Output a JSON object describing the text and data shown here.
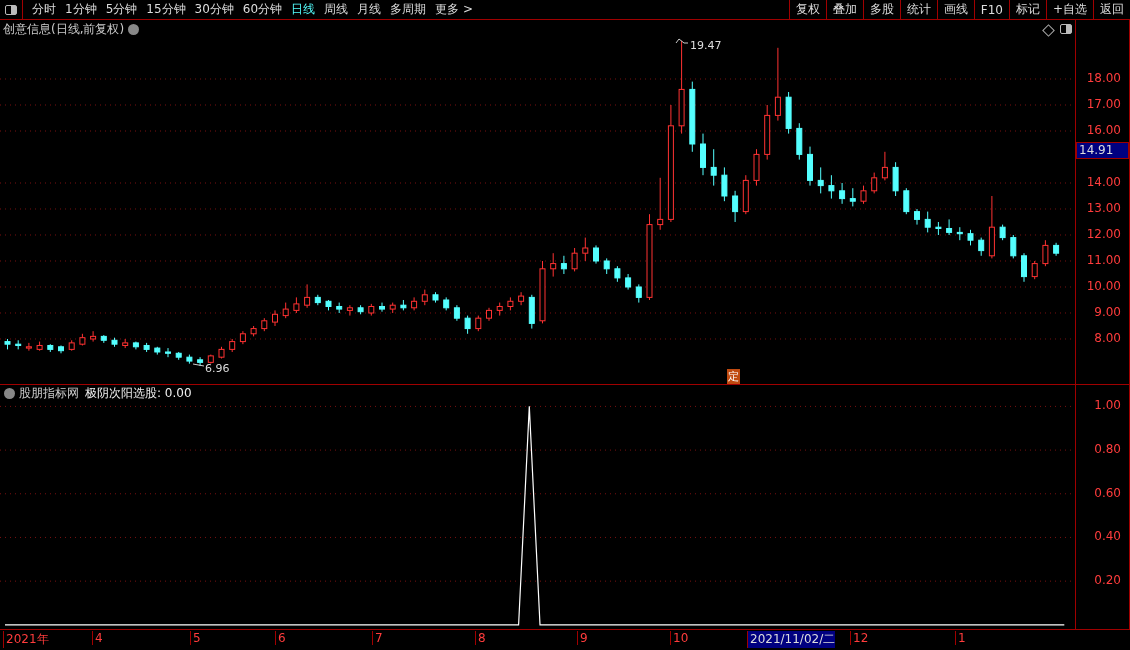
{
  "toolbar": {
    "periods": [
      {
        "label": "分时",
        "selected": false
      },
      {
        "label": "1分钟",
        "selected": false
      },
      {
        "label": "5分钟",
        "selected": false
      },
      {
        "label": "15分钟",
        "selected": false
      },
      {
        "label": "30分钟",
        "selected": false
      },
      {
        "label": "60分钟",
        "selected": false
      },
      {
        "label": "日线",
        "selected": true
      },
      {
        "label": "周线",
        "selected": false
      },
      {
        "label": "月线",
        "selected": false
      },
      {
        "label": "多周期",
        "selected": false
      }
    ],
    "more": "更多 >",
    "actions": [
      "复权",
      "叠加",
      "多股",
      "统计",
      "画线",
      "F10",
      "标记",
      "+自选",
      "返回"
    ]
  },
  "main_chart": {
    "title": "创意信息(日线,前复权)",
    "high_marker": "19.47",
    "low_marker": "6.96",
    "event_marker": "定",
    "price_tag": "14.91",
    "chart_data": {
      "type": "candlestick",
      "grid": true,
      "ylim": [
        6.23,
        20.27
      ],
      "yticks": [
        {
          "value": 18,
          "label": "18.00"
        },
        {
          "value": 17,
          "label": "17.00"
        },
        {
          "value": 16,
          "label": "16.00"
        },
        {
          "value": 14,
          "label": "14.00"
        },
        {
          "value": 13,
          "label": "13.00"
        },
        {
          "value": 12,
          "label": "12.00"
        },
        {
          "value": 11,
          "label": "11.00"
        },
        {
          "value": 10,
          "label": "10.00"
        },
        {
          "value": 9,
          "label": "9.00"
        },
        {
          "value": 8,
          "label": "8.00"
        }
      ],
      "ohlc": [
        [
          7.9,
          8.0,
          7.6,
          7.8
        ],
        [
          7.8,
          7.95,
          7.6,
          7.75
        ],
        [
          7.65,
          7.85,
          7.55,
          7.7
        ],
        [
          7.6,
          7.9,
          7.55,
          7.75
        ],
        [
          7.75,
          7.8,
          7.5,
          7.6
        ],
        [
          7.7,
          7.75,
          7.45,
          7.55
        ],
        [
          7.6,
          7.95,
          7.55,
          7.85
        ],
        [
          7.8,
          8.2,
          7.75,
          8.05
        ],
        [
          8.0,
          8.3,
          7.9,
          8.1
        ],
        [
          8.1,
          8.15,
          7.85,
          7.95
        ],
        [
          7.95,
          8.05,
          7.7,
          7.8
        ],
        [
          7.75,
          8.0,
          7.65,
          7.85
        ],
        [
          7.85,
          7.9,
          7.6,
          7.7
        ],
        [
          7.75,
          7.85,
          7.5,
          7.6
        ],
        [
          7.65,
          7.7,
          7.4,
          7.5
        ],
        [
          7.5,
          7.65,
          7.3,
          7.45
        ],
        [
          7.45,
          7.5,
          7.2,
          7.3
        ],
        [
          7.3,
          7.4,
          7.05,
          7.15
        ],
        [
          7.2,
          7.3,
          6.96,
          7.1
        ],
        [
          7.1,
          7.4,
          7.05,
          7.35
        ],
        [
          7.3,
          7.7,
          7.25,
          7.6
        ],
        [
          7.6,
          8.0,
          7.5,
          7.9
        ],
        [
          7.9,
          8.3,
          7.8,
          8.2
        ],
        [
          8.2,
          8.5,
          8.1,
          8.4
        ],
        [
          8.4,
          8.8,
          8.3,
          8.7
        ],
        [
          8.65,
          9.1,
          8.5,
          8.95
        ],
        [
          8.9,
          9.4,
          8.8,
          9.15
        ],
        [
          9.1,
          9.6,
          9.0,
          9.35
        ],
        [
          9.3,
          10.1,
          9.2,
          9.6
        ],
        [
          9.6,
          9.7,
          9.3,
          9.4
        ],
        [
          9.45,
          9.5,
          9.1,
          9.25
        ],
        [
          9.25,
          9.4,
          9.0,
          9.15
        ],
        [
          9.1,
          9.3,
          8.9,
          9.2
        ],
        [
          9.2,
          9.3,
          8.95,
          9.05
        ],
        [
          9.0,
          9.35,
          8.9,
          9.25
        ],
        [
          9.25,
          9.4,
          9.05,
          9.15
        ],
        [
          9.15,
          9.4,
          9.0,
          9.3
        ],
        [
          9.3,
          9.5,
          9.1,
          9.2
        ],
        [
          9.2,
          9.6,
          9.1,
          9.45
        ],
        [
          9.45,
          9.9,
          9.3,
          9.7
        ],
        [
          9.7,
          9.8,
          9.4,
          9.5
        ],
        [
          9.5,
          9.6,
          9.1,
          9.2
        ],
        [
          9.2,
          9.3,
          8.7,
          8.8
        ],
        [
          8.8,
          8.9,
          8.2,
          8.4
        ],
        [
          8.4,
          8.9,
          8.3,
          8.8
        ],
        [
          8.8,
          9.2,
          8.7,
          9.1
        ],
        [
          9.1,
          9.4,
          8.9,
          9.25
        ],
        [
          9.25,
          9.6,
          9.1,
          9.45
        ],
        [
          9.45,
          9.8,
          9.3,
          9.65
        ],
        [
          9.6,
          9.7,
          8.4,
          8.6
        ],
        [
          8.7,
          11.0,
          8.6,
          10.7
        ],
        [
          10.7,
          11.3,
          10.4,
          10.9
        ],
        [
          10.9,
          11.2,
          10.5,
          10.7
        ],
        [
          10.7,
          11.5,
          10.6,
          11.3
        ],
        [
          11.3,
          11.9,
          11.0,
          11.5
        ],
        [
          11.5,
          11.6,
          10.9,
          11.0
        ],
        [
          11.0,
          11.1,
          10.5,
          10.7
        ],
        [
          10.7,
          10.8,
          10.2,
          10.35
        ],
        [
          10.35,
          10.5,
          9.9,
          10.0
        ],
        [
          10.0,
          10.1,
          9.4,
          9.6
        ],
        [
          9.6,
          12.8,
          9.5,
          12.4
        ],
        [
          12.4,
          14.2,
          12.2,
          12.6
        ],
        [
          12.6,
          17.0,
          12.5,
          16.2
        ],
        [
          16.2,
          19.47,
          15.9,
          17.6
        ],
        [
          17.6,
          17.9,
          15.2,
          15.5
        ],
        [
          15.5,
          15.9,
          14.3,
          14.6
        ],
        [
          14.6,
          15.3,
          13.9,
          14.3
        ],
        [
          14.3,
          14.6,
          13.3,
          13.5
        ],
        [
          13.5,
          13.7,
          12.5,
          12.9
        ],
        [
          12.9,
          14.3,
          12.8,
          14.1
        ],
        [
          14.1,
          15.3,
          13.9,
          15.1
        ],
        [
          15.1,
          17.0,
          14.9,
          16.6
        ],
        [
          16.6,
          19.2,
          16.4,
          17.3
        ],
        [
          17.3,
          17.5,
          15.9,
          16.1
        ],
        [
          16.1,
          16.3,
          14.9,
          15.1
        ],
        [
          15.1,
          15.4,
          13.9,
          14.1
        ],
        [
          14.1,
          14.6,
          13.6,
          13.9
        ],
        [
          13.9,
          14.3,
          13.4,
          13.7
        ],
        [
          13.7,
          14.0,
          13.2,
          13.4
        ],
        [
          13.4,
          13.8,
          13.1,
          13.3
        ],
        [
          13.3,
          13.9,
          13.2,
          13.7
        ],
        [
          13.7,
          14.4,
          13.6,
          14.2
        ],
        [
          14.2,
          15.2,
          14.1,
          14.6
        ],
        [
          14.6,
          14.8,
          13.5,
          13.7
        ],
        [
          13.7,
          13.8,
          12.8,
          12.9
        ],
        [
          12.9,
          13.0,
          12.4,
          12.6
        ],
        [
          12.6,
          12.9,
          12.1,
          12.3
        ],
        [
          12.3,
          12.5,
          12.0,
          12.25
        ],
        [
          12.25,
          12.6,
          12.0,
          12.1
        ],
        [
          12.1,
          12.3,
          11.8,
          12.05
        ],
        [
          12.05,
          12.2,
          11.6,
          11.8
        ],
        [
          11.8,
          11.9,
          11.2,
          11.4
        ],
        [
          11.2,
          13.5,
          11.1,
          12.3
        ],
        [
          12.3,
          12.4,
          11.8,
          11.9
        ],
        [
          11.9,
          12.0,
          11.1,
          11.2
        ],
        [
          11.2,
          11.3,
          10.2,
          10.4
        ],
        [
          10.4,
          11.0,
          10.3,
          10.9
        ],
        [
          10.9,
          11.8,
          10.8,
          11.6
        ],
        [
          11.6,
          11.7,
          11.2,
          11.3
        ]
      ]
    }
  },
  "indicator": {
    "source": "股朋指标网",
    "label": "极阴次阳选股: 0.00",
    "chart_data": {
      "type": "line",
      "grid": true,
      "ylim": [
        -0.01,
        1.098
      ],
      "yticks": [
        {
          "value": 1,
          "label": "1.00"
        },
        {
          "value": 0.8,
          "label": "0.80"
        },
        {
          "value": 0.6,
          "label": "0.60"
        },
        {
          "value": 0.4,
          "label": "0.40"
        },
        {
          "value": 0.2,
          "label": "0.20"
        }
      ],
      "series": [
        {
          "color": "#ffffff",
          "values": [
            0,
            0,
            0,
            0,
            0,
            0,
            0,
            0,
            0,
            0,
            0,
            0,
            0,
            0,
            0,
            0,
            0,
            0,
            0,
            0,
            0,
            0,
            0,
            0,
            0,
            0,
            0,
            0,
            0,
            0,
            0,
            0,
            0,
            0,
            0,
            0,
            0,
            0,
            0,
            0,
            0,
            0,
            0,
            0,
            0,
            0,
            0,
            0,
            0,
            1,
            0,
            0,
            0,
            0,
            0,
            0,
            0,
            0,
            0,
            0,
            0,
            0,
            0,
            0,
            0,
            0,
            0,
            0,
            0,
            0,
            0,
            0,
            0,
            0,
            0,
            0,
            0,
            0,
            0,
            0,
            0,
            0,
            0,
            0,
            0,
            0,
            0,
            0,
            0,
            0,
            0,
            0,
            0,
            0,
            0,
            0,
            0,
            0,
            0,
            0
          ]
        }
      ]
    }
  },
  "date_axis": [
    {
      "label": "2021年",
      "selected": false
    },
    {
      "label": "4",
      "selected": false
    },
    {
      "label": "5",
      "selected": false
    },
    {
      "label": "6",
      "selected": false
    },
    {
      "label": "7",
      "selected": false
    },
    {
      "label": "8",
      "selected": false
    },
    {
      "label": "9",
      "selected": false
    },
    {
      "label": "10",
      "selected": false
    },
    {
      "label": "2021/11/02/二",
      "selected": true
    },
    {
      "label": "12",
      "selected": false
    },
    {
      "label": "1",
      "selected": false
    }
  ]
}
